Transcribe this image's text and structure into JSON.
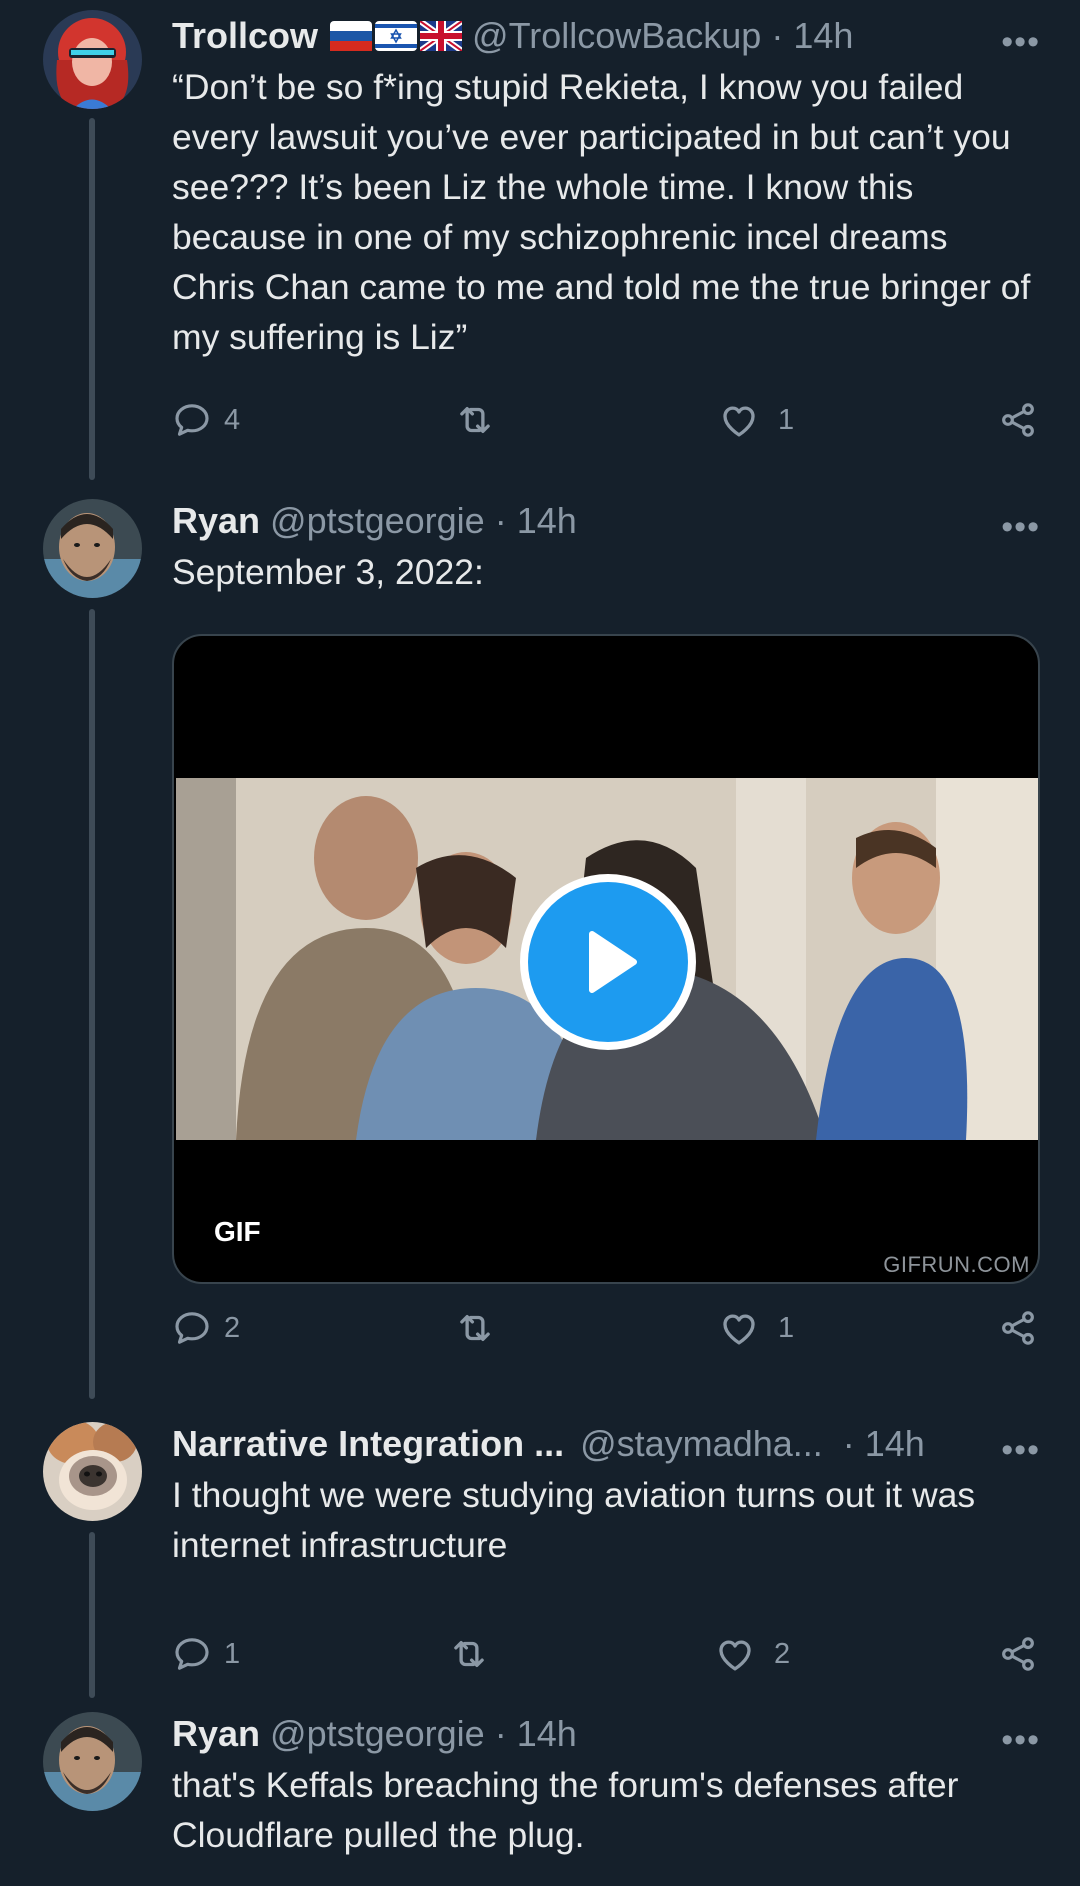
{
  "tweets": [
    {
      "name": "Trollcow",
      "handle": "@TrollcowBackup",
      "time": "· 14h",
      "text": "“Don’t be so f*ing stupid Rekieta, I know you failed every lawsuit you’ve ever participated in but can’t you see??? It’s been Liz the whole time. I know this because in one of my schizophrenic incel dreams Chris Chan came to me and told me the true bringer of my suffering is Liz”",
      "replies": "4",
      "retweets": "",
      "likes": "1",
      "flags": [
        "russia-flag-icon",
        "israel-flag-icon",
        "uk-flag-icon"
      ]
    },
    {
      "name": "Ryan",
      "handle": "@ptstgeorgie",
      "time": "· 14h",
      "text": "September 3, 2022:",
      "replies": "2",
      "retweets": "",
      "likes": "1",
      "media": {
        "badge": "GIF",
        "watermark": "GIFRUN.COM"
      }
    },
    {
      "name": "Narrative Integration ...",
      "handle": "@staymadha...",
      "time": "· 14h",
      "text": "I thought we were studying aviation turns out it was internet infrastructure",
      "replies": "1",
      "retweets": "",
      "likes": "2"
    },
    {
      "name": "Ryan",
      "handle": "@ptstgeorgie",
      "time": "· 14h",
      "text": "that's Keffals breaching the forum's defenses after Cloudflare pulled the plug."
    }
  ],
  "icons": {
    "more": "more-options-icon",
    "reply": "reply-icon",
    "retweet": "retweet-icon",
    "like": "like-icon",
    "share": "share-icon",
    "play": "play-icon"
  },
  "colors": {
    "background": "#15202b",
    "text": "#e7e9ea",
    "secondary": "#8b98a5",
    "accent": "#1d9bf0"
  }
}
